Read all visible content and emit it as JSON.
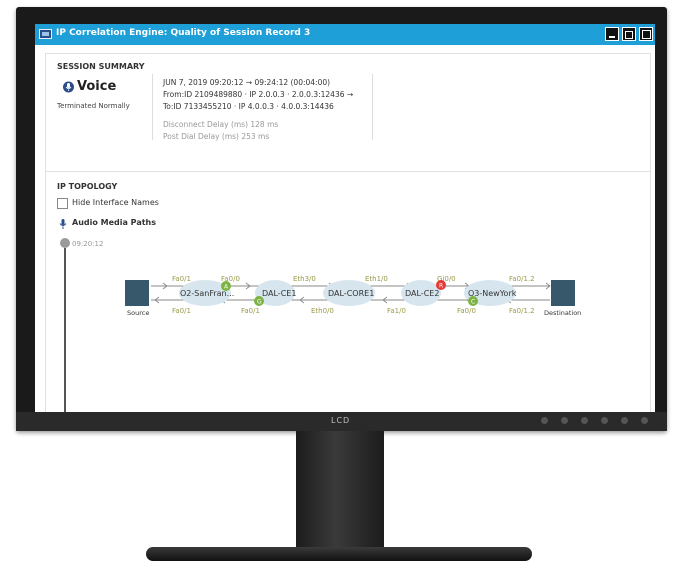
{
  "window": {
    "title": "IP Correlation Engine: Quality of Session Record 3"
  },
  "monitor": {
    "brand": "LCD"
  },
  "session_summary": {
    "heading": "SESSION SUMMARY",
    "type_label": "Voice",
    "status": "Terminated Normally",
    "line1": "JUN 7, 2019 09:20:12 → 09:24:12 (00:04:00)",
    "line2": "From:ID 2109489880 · IP 2.0.0.3 ·  2.0.0.3:12436 →",
    "line3": "To:ID 7133455210 · IP 4.0.0.3 ·  4.0.0.3:14436",
    "disconnect_delay": "Disconnect Delay (ms) 128 ms",
    "post_dial_delay": "Post Dial Delay (ms) 253 ms"
  },
  "topology": {
    "heading": "IP TOPOLOGY",
    "hide_names_label": "Hide Interface Names",
    "audio_paths_label": "Audio Media Paths",
    "timestamp": "09:20:12",
    "source_label": "Source",
    "destination_label": "Destination",
    "nodes": [
      "O2-SanFran...",
      "DAL-CE1",
      "DAL-CORE1",
      "DAL-CE2",
      "O3-NewYork"
    ],
    "top_interfaces": [
      "Fa0/1",
      "Fa0/0",
      "Eth3/0",
      "Eth1/0",
      "Gi0/0",
      "Fa0/1.2"
    ],
    "bottom_interfaces": [
      "Fa0/1",
      "Fa0/1",
      "Eth0/0",
      "Fa1/0",
      "Fa0/0",
      "Fa0/1.2"
    ],
    "badges": [
      {
        "letter": "A",
        "color": "#7cb342"
      },
      {
        "letter": "G",
        "color": "#7cb342"
      },
      {
        "letter": "R",
        "color": "#e53935"
      },
      {
        "letter": "C",
        "color": "#7cb342"
      }
    ]
  },
  "colors": {
    "titlebar": "#1f9fd8",
    "endpoint": "#37576a",
    "router": "#d7e6ee"
  }
}
